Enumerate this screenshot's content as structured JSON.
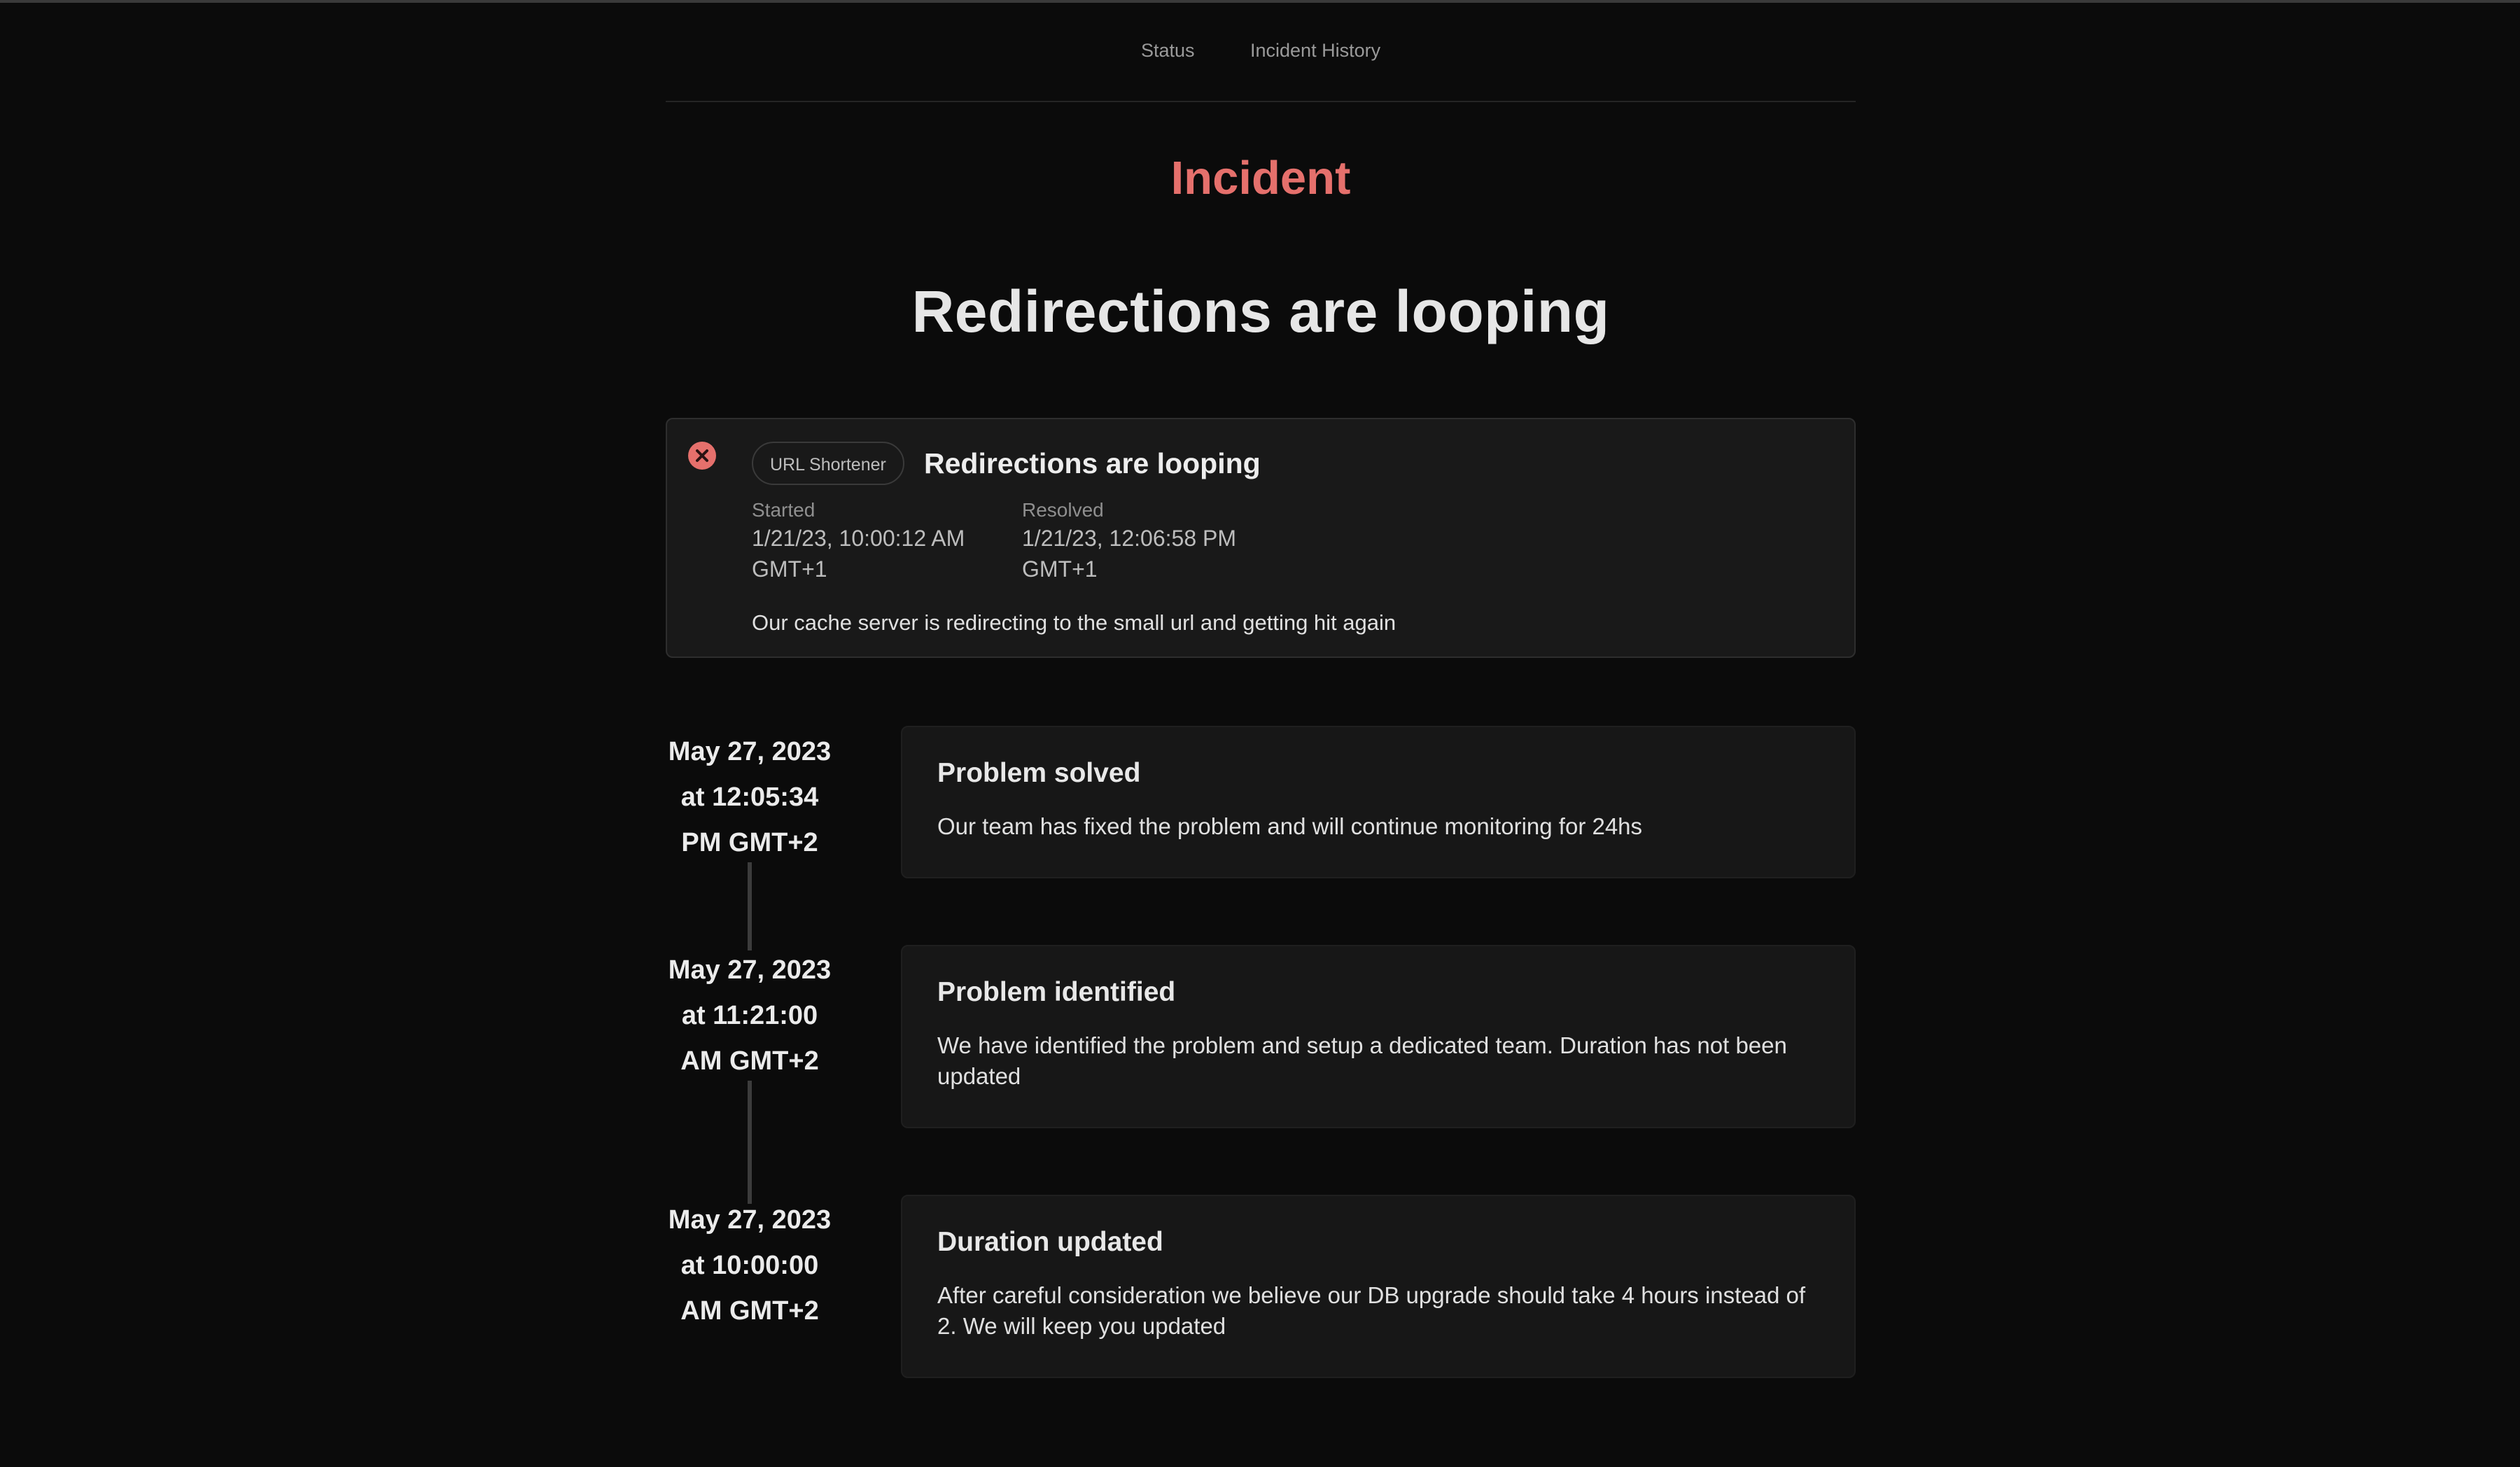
{
  "nav": {
    "status_label": "Status",
    "history_label": "Incident History"
  },
  "page": {
    "kicker": "Incident",
    "title": "Redirections are looping"
  },
  "incident": {
    "status": "resolved",
    "status_icon": "close-circle-icon",
    "accent_color": "#e5706c",
    "service": "URL Shortener",
    "title": "Redirections are looping",
    "started_label": "Started",
    "started_date": "1/21/23, 10:00:12 AM",
    "started_tz": "GMT+1",
    "resolved_label": "Resolved",
    "resolved_date": "1/21/23, 12:06:58 PM",
    "resolved_tz": "GMT+1",
    "description": "Our cache server is redirecting to the small url and getting hit again"
  },
  "updates": [
    {
      "date_line1": "May 27, 2023",
      "date_line2": "at 12:05:34",
      "date_line3": "PM GMT+2",
      "title": "Problem solved",
      "body": "Our team has fixed the problem and will continue monitoring for 24hs"
    },
    {
      "date_line1": "May 27, 2023",
      "date_line2": "at 11:21:00",
      "date_line3": "AM GMT+2",
      "title": "Problem identified",
      "body": "We have identified the problem and setup a dedicated team. Duration has not been updated"
    },
    {
      "date_line1": "May 27, 2023",
      "date_line2": "at 10:00:00",
      "date_line3": "AM GMT+2",
      "title": "Duration updated",
      "body": "After careful consideration we believe our DB upgrade should take 4 hours instead of 2. We will keep you updated"
    }
  ]
}
